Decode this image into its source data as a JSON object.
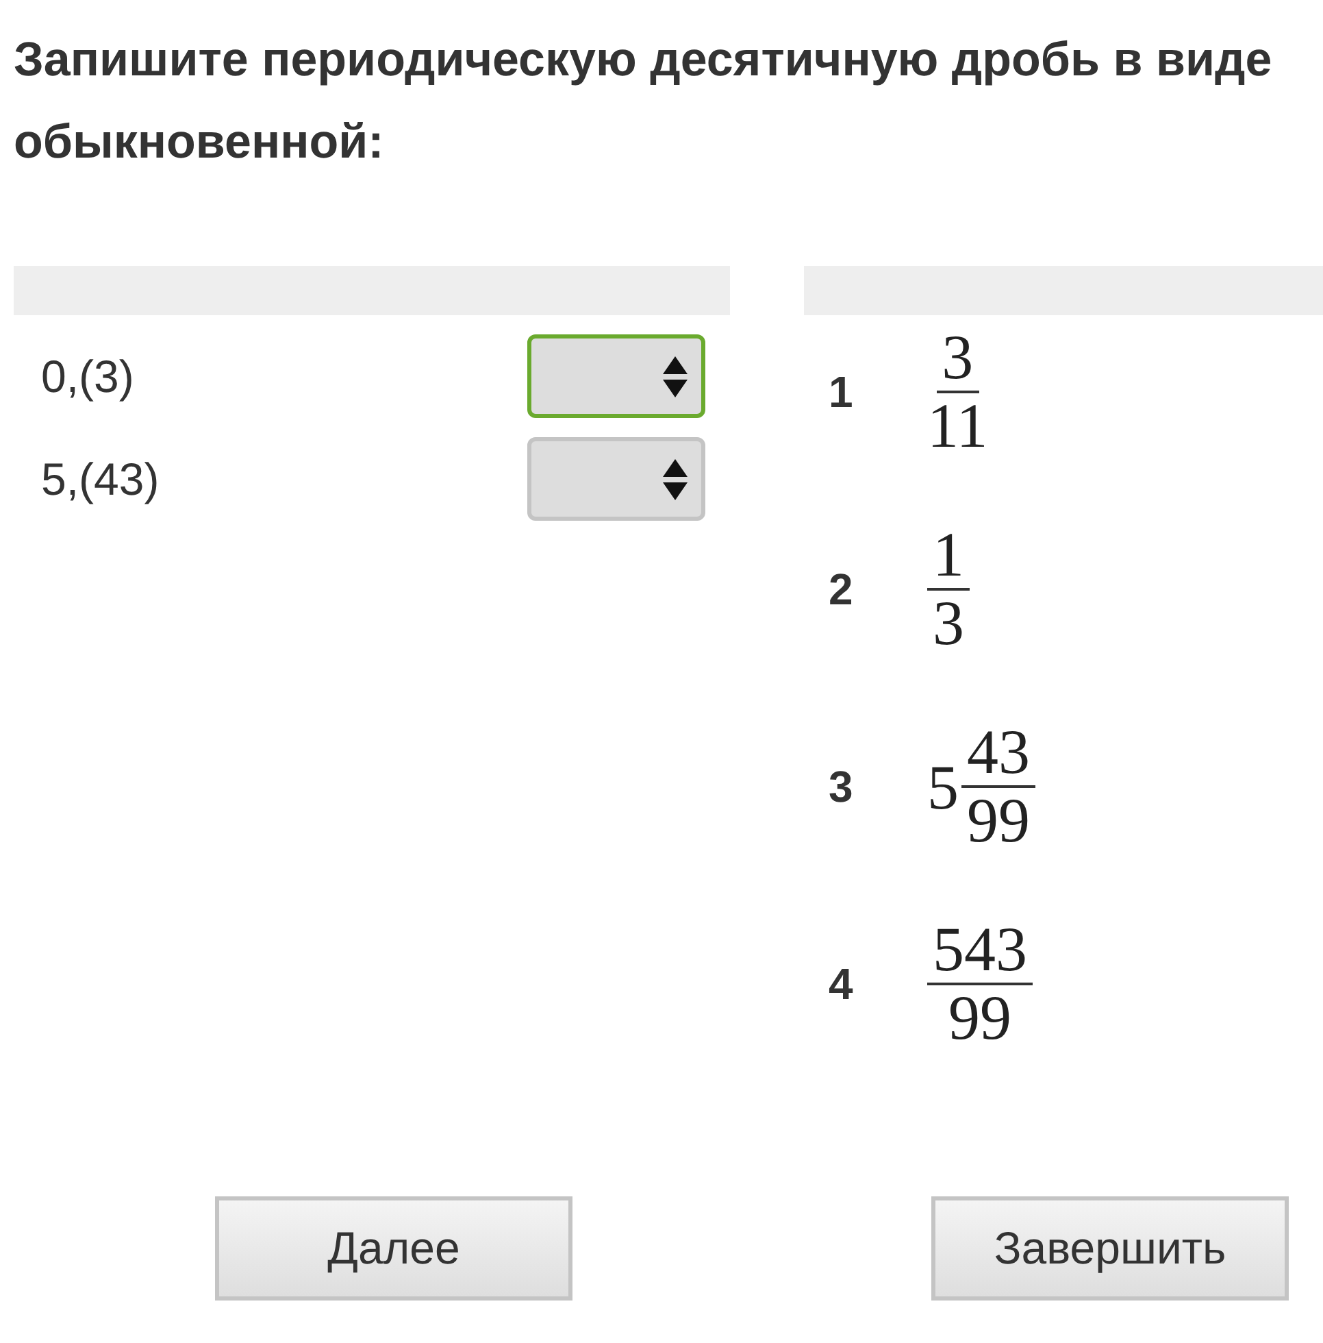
{
  "question": "Запишите периодическую десятичную дробь в виде обыкновенной:",
  "items": [
    {
      "label": "0,(3)",
      "focused": true
    },
    {
      "label": "5,(43)",
      "focused": false
    }
  ],
  "options": [
    {
      "number": "1",
      "numerator": "3",
      "denominator": "11"
    },
    {
      "number": "2",
      "numerator": "1",
      "denominator": "3"
    },
    {
      "number": "3",
      "whole": "5",
      "numerator": "43",
      "denominator": "99"
    },
    {
      "number": "4",
      "numerator": "543",
      "denominator": "99"
    }
  ],
  "buttons": [
    "Далее",
    "Завершить"
  ]
}
